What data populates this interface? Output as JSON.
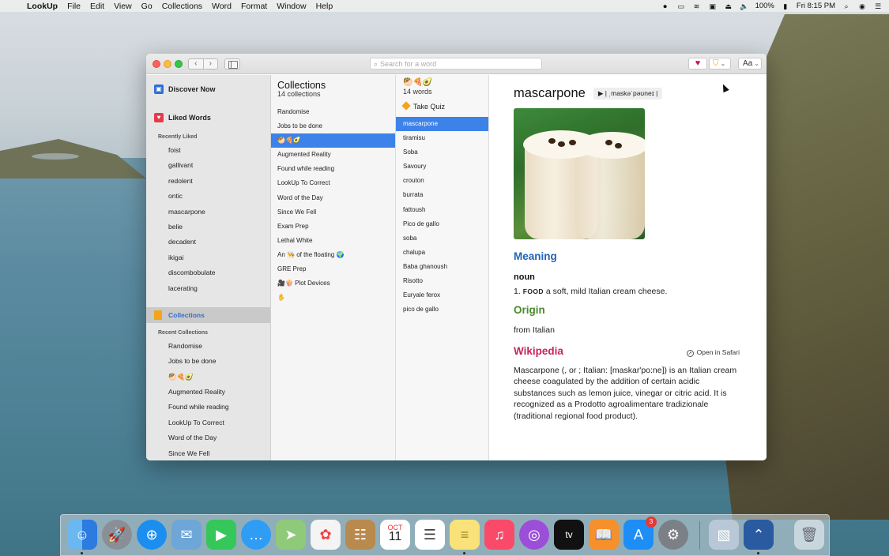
{
  "menubar": {
    "app_name": "LookUp",
    "items": [
      "File",
      "Edit",
      "View",
      "Go",
      "Collections",
      "Word",
      "Format",
      "Window",
      "Help"
    ],
    "battery": "100%",
    "clock": "Fri 8:15 PM"
  },
  "toolbar": {
    "search_placeholder": "Search for a word",
    "font_button": "Aa"
  },
  "sidebar": {
    "discover_label": "Discover Now",
    "liked_label": "Liked Words",
    "recently_liked_header": "Recently Liked",
    "recently_liked": [
      "foist",
      "gallivant",
      "redolent",
      "ontic",
      "mascarpone",
      "belie",
      "decadent",
      "ikigai",
      "discombobulate",
      "lacerating"
    ],
    "collections_label": "Collections",
    "recent_collections_header": "Recent Collections",
    "recent_collections": [
      "Randomise",
      "Jobs to be done",
      "🥙🍕🥑",
      "Augmented Reality",
      "Found while reading",
      "LookUp To Correct",
      "Word of the Day",
      "Since We Fell"
    ]
  },
  "collections": {
    "title": "Collections",
    "count": "14 collections",
    "items": [
      "Randomise",
      "Jobs to be done",
      "🥙🍕🥑",
      "Augmented Reality",
      "Found while reading",
      "LookUp To Correct",
      "Word of the Day",
      "Since We Fell",
      "Exam Prep",
      "Lethal White",
      "An 👨‍🍳 of the floating 🌍",
      "GRE Prep",
      "🎥🍿 Plot Devices",
      "✋"
    ],
    "selected_index": 2
  },
  "words": {
    "emoji_title": "🥙🍕🥑",
    "count": "14 words",
    "quiz_label": "Take Quiz",
    "items": [
      "mascarpone",
      "tiramisu",
      "Soba",
      "Savoury",
      "crouton",
      "burrata",
      "fattoush",
      "Pico de gallo",
      "soba",
      "chalupa",
      "Baba ghanoush",
      "Risotto",
      "Euryale ferox",
      "pico de gallo"
    ],
    "selected_index": 0
  },
  "detail": {
    "word": "mascarpone",
    "pronunciation": "▶ | ˌmaskəˈpəʊneɪ |",
    "meaning_header": "Meaning",
    "part_of_speech": "noun",
    "definition_number": "1.",
    "definition_category": "FOOD",
    "definition_text": "a soft, mild Italian cream cheese.",
    "origin_header": "Origin",
    "origin_text": "from Italian",
    "wikipedia_header": "Wikipedia",
    "open_in_safari": "Open in Safari",
    "wikipedia_text": "Mascarpone (, or ; Italian: [maskar'po:ne]) is an Italian cream cheese coagulated by the addition of certain acidic substances such as lemon juice, vinegar or citric acid. It is recognized as a Prodotto agroalimentare tradizionale (traditional regional food product)."
  },
  "dock": {
    "icons": [
      "finder-icon",
      "launchpad-icon",
      "safari-icon",
      "mail-icon",
      "facetime-icon",
      "messages-icon",
      "maps-icon",
      "photos-icon",
      "contacts-icon",
      "calendar-icon",
      "reminders-icon",
      "notes-icon",
      "music-icon",
      "podcasts-icon",
      "tv-icon",
      "books-icon",
      "app-store-icon",
      "system-preferences-icon",
      "preview-icon",
      "xcode-icon",
      "trash-icon"
    ],
    "calendar_month": "OCT",
    "calendar_day": "11",
    "tv_label": "tv",
    "app_store_badge": "3"
  }
}
